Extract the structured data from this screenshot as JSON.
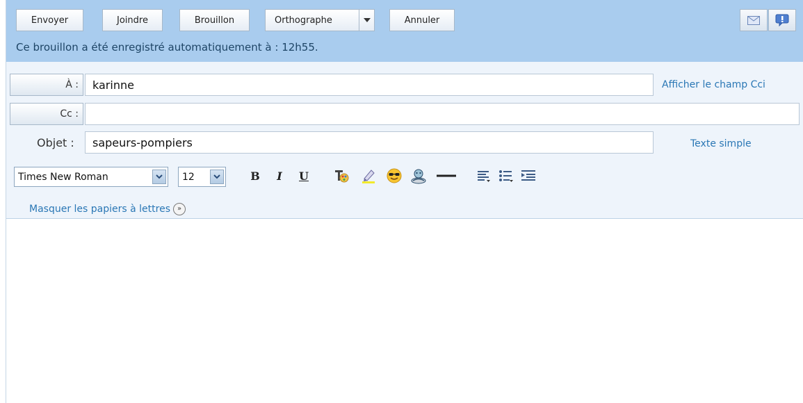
{
  "toolbar": {
    "send": "Envoyer",
    "attach": "Joindre",
    "draft": "Brouillon",
    "spelling": "Orthographe",
    "cancel": "Annuler"
  },
  "icons": {
    "mail": "envelope-icon",
    "priority": "exclamation-icon"
  },
  "autosave": "Ce brouillon a été enregistré automatiquement à : 12h55.",
  "fields": {
    "to_label": "À :",
    "to_value": "karinne",
    "cc_label": "Cc :",
    "cc_value": "",
    "subject_label": "Objet :",
    "subject_value": "sapeurs-pompiers",
    "show_bcc": "Afficher le champ Cci",
    "plain_text": "Texte simple"
  },
  "format": {
    "font": "Times New Roman",
    "size": "12",
    "bold": "B",
    "italic": "I",
    "underline": "U",
    "hide_stationery": "Masquer les papiers à lettres",
    "stationery_icon": "double-chevron-icon"
  },
  "colors": {
    "toolbar_bg": "#a9ccee",
    "header_bg": "#eef4fb",
    "link": "#2a77b5"
  }
}
